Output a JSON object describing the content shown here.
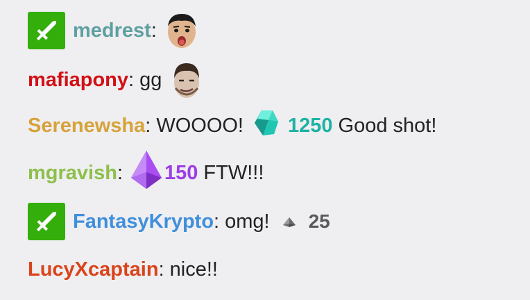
{
  "colors": {
    "background": "#efeef1",
    "text": "#222222",
    "badge_green": "#34ae0a",
    "bits_teal": "#1db2a5",
    "bits_purple": "#9c3ee8",
    "bits_gray": "#5a5a5a"
  },
  "messages": [
    {
      "badge": "moderator-sword-icon",
      "username": "medrest",
      "username_color": "#5e9fa0",
      "separator": ":",
      "text": "",
      "emote": "surprised-face-emote"
    },
    {
      "username": "mafiapony",
      "username_color": "#d20f15",
      "separator": ":",
      "text": "gg",
      "emote": "smirking-face-emote"
    },
    {
      "username": "Serenewsha",
      "username_color": "#d6a339",
      "separator": ":",
      "text": "WOOOO!",
      "bits": {
        "icon": "teal-gem-icon",
        "amount": "1250",
        "color": "#1db2a5"
      },
      "text_after": "Good shot!"
    },
    {
      "username": "mgravish",
      "username_color": "#8dc04a",
      "separator": ":",
      "bits": {
        "icon": "purple-gem-icon",
        "amount": "150",
        "color": "#9c3ee8"
      },
      "text_after": "FTW!!!"
    },
    {
      "badge": "moderator-sword-icon",
      "username": "FantasyKrypto",
      "username_color": "#3f8fdb",
      "separator": ":",
      "text": "omg!",
      "bits": {
        "icon": "gray-gem-icon",
        "amount": "25",
        "color": "#5a5a5a"
      }
    },
    {
      "username": "LucyXcaptain",
      "username_color": "#d9441b",
      "separator": ":",
      "text": "nice!!"
    }
  ]
}
